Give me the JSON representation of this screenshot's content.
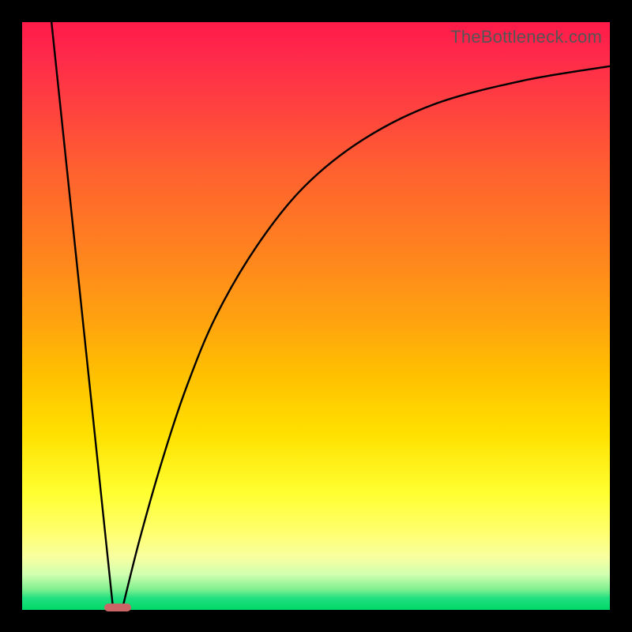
{
  "watermark": "TheBottleneck.com",
  "colors": {
    "frame": "#000000",
    "curve": "#000000",
    "marker": "#cc6666",
    "gradient_top": "#ff1a4a",
    "gradient_bottom": "#00d868"
  },
  "chart_data": {
    "type": "line",
    "title": "",
    "xlabel": "",
    "ylabel": "",
    "xlim": [
      0,
      100
    ],
    "ylim": [
      0,
      100
    ],
    "grid": false,
    "series": [
      {
        "name": "left-branch",
        "x": [
          5,
          15.5
        ],
        "y": [
          100,
          0
        ]
      },
      {
        "name": "right-branch",
        "x": [
          17,
          20,
          24,
          28,
          33,
          40,
          48,
          58,
          70,
          85,
          100
        ],
        "y": [
          0,
          12,
          26,
          38,
          50,
          62,
          72,
          80,
          86,
          90,
          92.5
        ]
      }
    ],
    "annotations": [
      {
        "name": "minimum-marker",
        "x_range": [
          14,
          18.5
        ],
        "y": 0
      }
    ]
  }
}
